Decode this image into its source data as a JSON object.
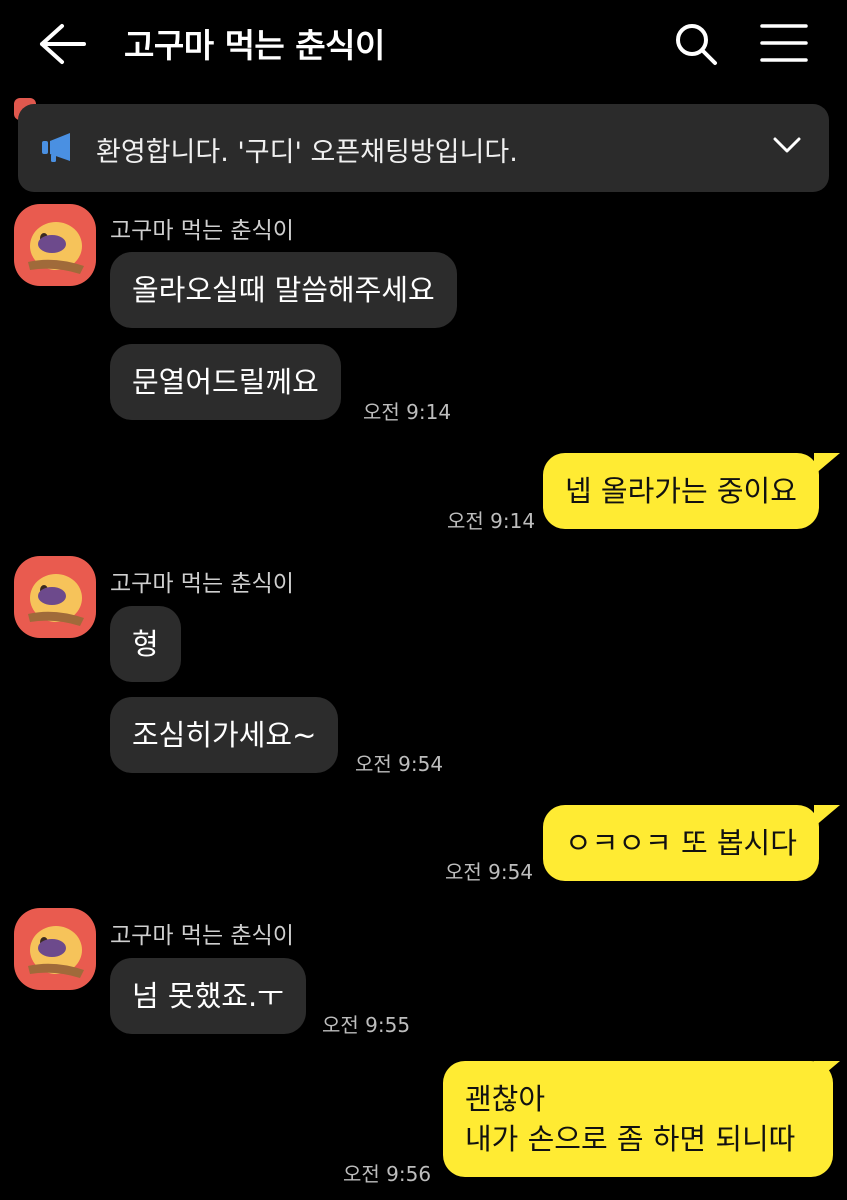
{
  "header": {
    "title": "고구마 먹는 춘식이"
  },
  "notice": {
    "text": "환영합니다. '구디' 오픈채팅방입니다."
  },
  "messages": [
    {
      "sender": "고구마 먹는 춘식이",
      "text": "올라오실때 말씀해주세요"
    },
    {
      "text": "문열어드릴께요",
      "time": "오전 9:14"
    },
    {
      "text": "넵 올라가는 중이요",
      "time": "오전 9:14"
    },
    {
      "sender": "고구마 먹는 춘식이",
      "text": "형"
    },
    {
      "text": "조심히가세요~",
      "time": "오전 9:54"
    },
    {
      "text": "ㅇㅋㅇㅋ 또 봅시다",
      "time": "오전 9:54"
    },
    {
      "sender": "고구마 먹는 춘식이",
      "text": "넘 못했죠.ㅜ",
      "time": "오전 9:55"
    },
    {
      "lines": [
        "괜찮아",
        "내가 손으로 좀 하면 되니따"
      ],
      "time": "오전 9:56"
    }
  ],
  "colors": {
    "background": "#000000",
    "other_bubble": "#2c2c2c",
    "my_bubble": "#ffeb33",
    "avatar": "#e95b4f",
    "notice_icon": "#4a90e2"
  },
  "icons": [
    "back-arrow-icon",
    "search-icon",
    "menu-icon",
    "megaphone-icon",
    "chevron-down-icon"
  ]
}
